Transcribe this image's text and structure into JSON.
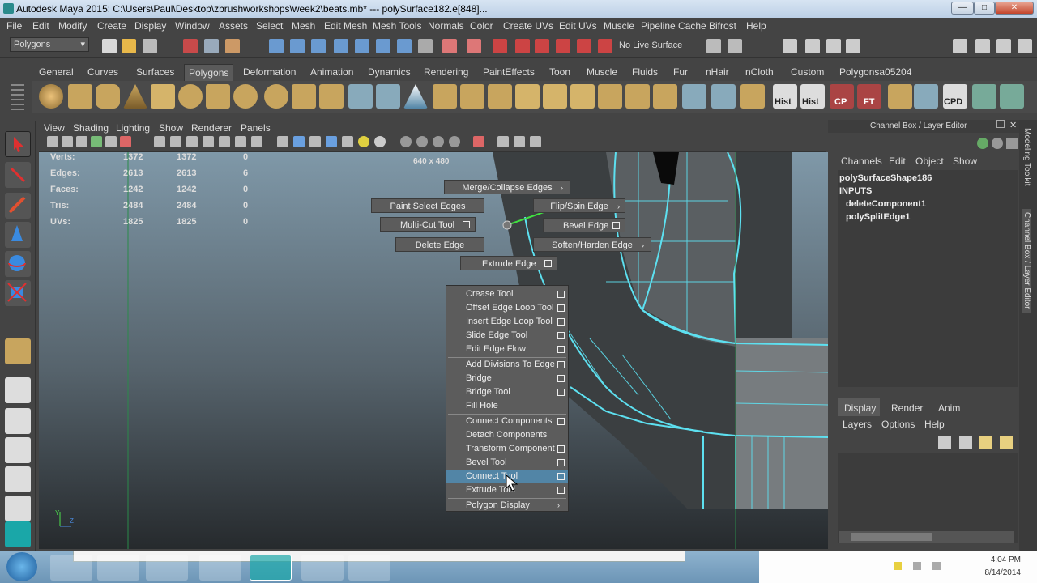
{
  "window": {
    "title": "Autodesk Maya 2015: C:\\Users\\Paul\\Desktop\\zbrushworkshops\\week2\\beats.mb*   ---   polySurface182.e[848]...",
    "min": "—",
    "max": "□",
    "close": "✕"
  },
  "menubar": [
    "File",
    "Edit",
    "Modify",
    "Create",
    "Display",
    "Window",
    "Assets",
    "Select",
    "Mesh",
    "Edit Mesh",
    "Mesh Tools",
    "Normals",
    "Color",
    "Create UVs",
    "Edit UVs",
    "Muscle",
    "Pipeline Cache",
    "Bifrost",
    "Help"
  ],
  "status": {
    "mode": "Polygons",
    "live_surface": "No Live Surface"
  },
  "shelf": {
    "tabs": [
      "General",
      "Curves",
      "Surfaces",
      "Polygons",
      "Deformation",
      "Animation",
      "Dynamics",
      "Rendering",
      "PaintEffects",
      "Toon",
      "Muscle",
      "Fluids",
      "Fur",
      "nHair",
      "nCloth",
      "Custom",
      "Polygonsa05204"
    ],
    "active_tab": "Polygons",
    "labels": [
      "Hist",
      "Hist",
      "CP",
      "FT",
      "CPD"
    ]
  },
  "panel": {
    "menus": [
      "View",
      "Shading",
      "Lighting",
      "Show",
      "Renderer",
      "Panels"
    ]
  },
  "hud": {
    "rows": [
      {
        "label": "Verts:",
        "a": "1372",
        "b": "1372",
        "c": "0"
      },
      {
        "label": "Edges:",
        "a": "2613",
        "b": "2613",
        "c": "6"
      },
      {
        "label": "Faces:",
        "a": "1242",
        "b": "1242",
        "c": "0"
      },
      {
        "label": "Tris:",
        "a": "2484",
        "b": "2484",
        "c": "0"
      },
      {
        "label": "UVs:",
        "a": "1825",
        "b": "1825",
        "c": "0"
      }
    ],
    "resolution": "640 x 480"
  },
  "marking_radial": [
    {
      "label": "Merge/Collapse Edges",
      "arrow": true
    },
    {
      "label": "Paint Select Edges"
    },
    {
      "label": "Flip/Spin Edge",
      "arrow": true
    },
    {
      "label": "Multi-Cut Tool",
      "box": true
    },
    {
      "label": "Bevel Edge",
      "box": true
    },
    {
      "label": "Delete Edge"
    },
    {
      "label": "Soften/Harden Edge",
      "arrow": true
    },
    {
      "label": "Extrude Edge",
      "box": true
    }
  ],
  "marking_menu": [
    {
      "label": "Crease Tool",
      "box": true
    },
    {
      "label": "Offset Edge Loop Tool",
      "box": true
    },
    {
      "label": "Insert Edge Loop Tool",
      "box": true
    },
    {
      "label": "Slide Edge Tool",
      "box": true
    },
    {
      "label": "Edit Edge Flow",
      "box": true
    },
    {
      "label": "Add Divisions To Edge",
      "box": true
    },
    {
      "label": "Bridge",
      "box": true
    },
    {
      "label": "Bridge Tool",
      "box": true
    },
    {
      "label": "Fill Hole",
      "box": false
    },
    {
      "label": "Connect Components",
      "box": true
    },
    {
      "label": "Detach Components",
      "box": false
    },
    {
      "label": "Transform Component",
      "box": true
    },
    {
      "label": "Bevel Tool",
      "box": true
    },
    {
      "label": "Connect Tool",
      "box": true,
      "highlighted": true
    },
    {
      "label": "Extrude Tool",
      "box": true
    },
    {
      "label": "Polygon Display",
      "arrow": true
    }
  ],
  "channel_box": {
    "title": "Channel Box / Layer Editor",
    "menus": [
      "Channels",
      "Edit",
      "Object",
      "Show"
    ],
    "shape": "polySurfaceShape186",
    "inputs_label": "INPUTS",
    "inputs": [
      "deleteComponent1",
      "polySplitEdge1"
    ]
  },
  "layer_editor": {
    "tabs": [
      "Display",
      "Render",
      "Anim"
    ],
    "menus": [
      "Layers",
      "Options",
      "Help"
    ]
  },
  "side_tabs": [
    "Modeling Toolkit",
    "Channel Box / Layer Editor"
  ],
  "axis": {
    "y": "Y",
    "z": "Z"
  },
  "clock": {
    "time": "4:04 PM",
    "date": "8/14/2014"
  },
  "colors": {
    "accent": "#5285a6",
    "wire": "#5de0f0",
    "maya_teal": "#1aa7a8"
  }
}
